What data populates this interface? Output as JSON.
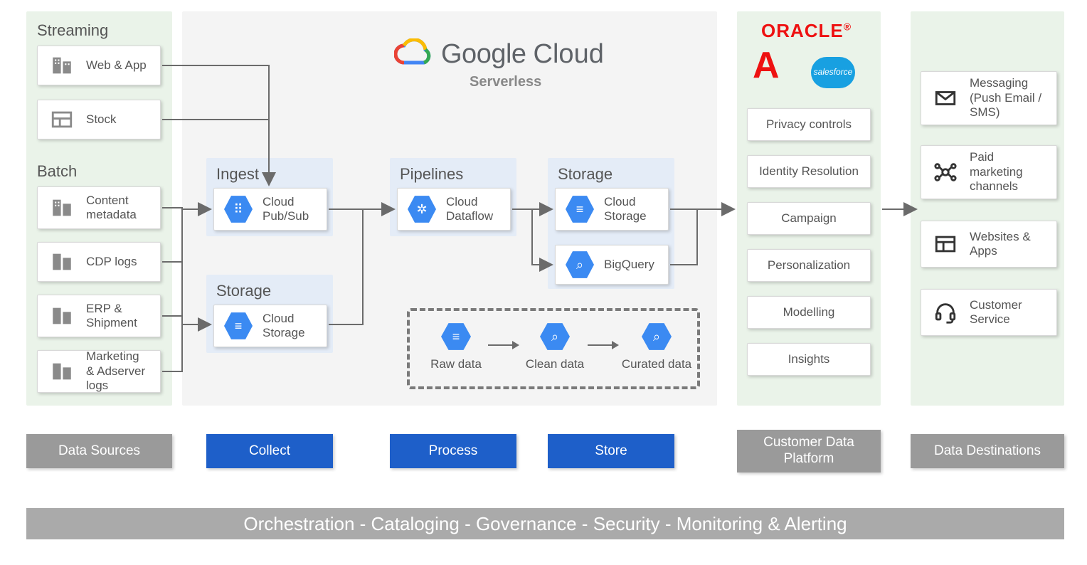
{
  "sources": {
    "streaming_label": "Streaming",
    "batch_label": "Batch",
    "streaming": [
      {
        "name": "Web & App"
      },
      {
        "name": "Stock"
      }
    ],
    "batch": [
      {
        "name": "Content metadata"
      },
      {
        "name": "CDP logs"
      },
      {
        "name": "ERP & Shipment"
      },
      {
        "name": "Marketing & Adserver logs"
      }
    ]
  },
  "google_cloud": {
    "title_google": "Google",
    "title_cloud": "Cloud",
    "subtitle": "Serverless",
    "ingest_label": "Ingest",
    "pipelines_label": "Pipelines",
    "storage_label_left": "Storage",
    "storage_label_right": "Storage",
    "pubsub": "Cloud Pub/Sub",
    "dataflow": "Cloud Dataflow",
    "storage_ingest": "Cloud Storage",
    "storage_out": "Cloud Storage",
    "bigquery": "BigQuery",
    "legend": {
      "raw": "Raw data",
      "clean": "Clean data",
      "curated": "Curated data"
    }
  },
  "cdp": {
    "items": [
      "Privacy controls",
      "Identity Resolution",
      "Campaign",
      "Personalization",
      "Modelling",
      "Insights"
    ]
  },
  "destinations": [
    "Messaging (Push Email / SMS)",
    "Paid marketing channels",
    "Websites & Apps",
    "Customer Service"
  ],
  "lane_labels": {
    "sources": "Data Sources",
    "collect": "Collect",
    "process": "Process",
    "store": "Store",
    "cdp": "Customer Data Platform",
    "dest": "Data Destinations"
  },
  "footer": "Orchestration - Cataloging - Governance - Security - Monitoring & Alerting"
}
